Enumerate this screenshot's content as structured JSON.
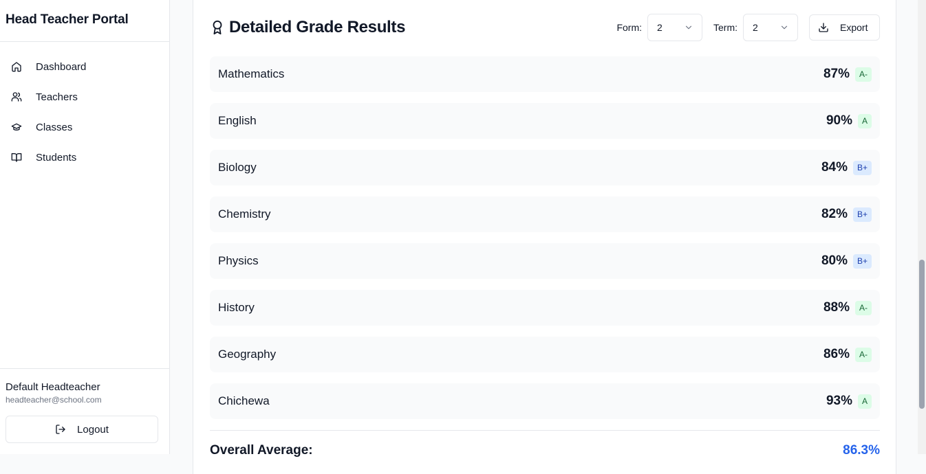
{
  "sidebar": {
    "brand": "Head Teacher Portal",
    "items": [
      {
        "label": "Dashboard",
        "icon": "home-icon"
      },
      {
        "label": "Teachers",
        "icon": "users-icon"
      },
      {
        "label": "Classes",
        "icon": "graduation-cap-icon"
      },
      {
        "label": "Students",
        "icon": "book-open-icon"
      }
    ],
    "user": {
      "name": "Default Headteacher",
      "email": "headteacher@school.com"
    },
    "logout_label": "Logout"
  },
  "main": {
    "title": "Detailed Grade Results",
    "title_icon": "award-icon",
    "form_label": "Form:",
    "form_value": "2",
    "term_label": "Term:",
    "term_value": "2",
    "export_label": "Export",
    "grades": [
      {
        "subject": "Mathematics",
        "percent": "87%",
        "grade": "A-",
        "badge_color": "green"
      },
      {
        "subject": "English",
        "percent": "90%",
        "grade": "A",
        "badge_color": "green"
      },
      {
        "subject": "Biology",
        "percent": "84%",
        "grade": "B+",
        "badge_color": "blue"
      },
      {
        "subject": "Chemistry",
        "percent": "82%",
        "grade": "B+",
        "badge_color": "blue"
      },
      {
        "subject": "Physics",
        "percent": "80%",
        "grade": "B+",
        "badge_color": "blue"
      },
      {
        "subject": "History",
        "percent": "88%",
        "grade": "A-",
        "badge_color": "green"
      },
      {
        "subject": "Geography",
        "percent": "86%",
        "grade": "A-",
        "badge_color": "green"
      },
      {
        "subject": "Chichewa",
        "percent": "93%",
        "grade": "A",
        "badge_color": "green"
      }
    ],
    "overall_label": "Overall Average:",
    "overall_value": "86.3%"
  },
  "colors": {
    "accent": "#2563eb",
    "badge_green_bg": "#dcfce7",
    "badge_blue_bg": "#dbeafe"
  }
}
